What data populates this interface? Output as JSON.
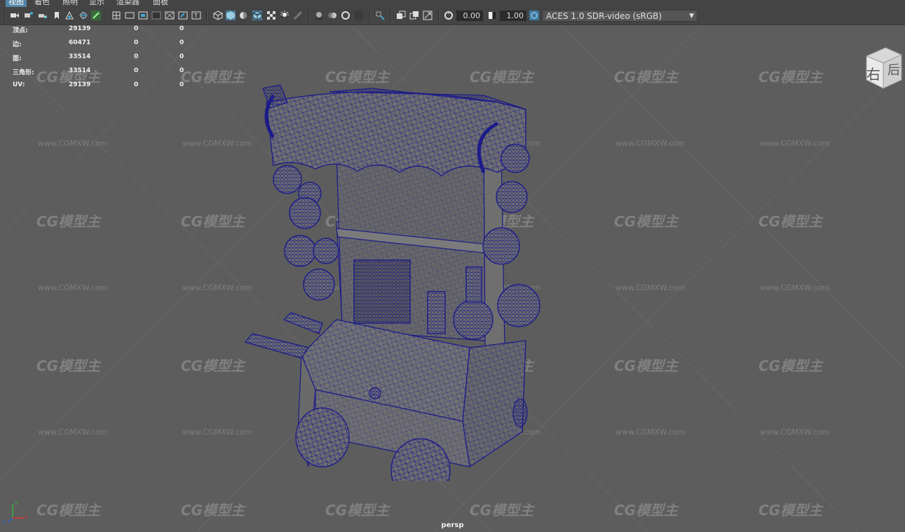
{
  "menu": {
    "items": [
      "视图",
      "着色",
      "照明",
      "显示",
      "渲染器",
      "面板"
    ]
  },
  "toolbar": {
    "exposure": "0.00",
    "gamma": "1.00",
    "color_space": "ACES 1.0 SDR-video (sRGB)",
    "icons": [
      "camera-icon",
      "camera-attributes-icon",
      "bookmark-icon",
      "image-plane-icon",
      "grid-icon",
      "film-gate-icon",
      "resolution-gate-icon",
      "gate-mask-icon",
      "field-chart-icon",
      "safe-action-icon",
      "wireframe-icon",
      "smooth-shade-icon",
      "shade-wireframe-icon",
      "textured-icon",
      "lights-icon",
      "shadows-icon",
      "ambient-occlusion-icon",
      "motion-blur-icon",
      "anti-alias-icon",
      "isolate-select-icon",
      "xray-icon",
      "xray-joints-icon",
      "backface-icon",
      "exposure-icon",
      "gamma-icon",
      "color-management-icon"
    ]
  },
  "hud": {
    "rows": [
      {
        "label": "顶点:",
        "v1": "29139",
        "v2": "0",
        "v3": "0"
      },
      {
        "label": "边:",
        "v1": "60471",
        "v2": "0",
        "v3": "0"
      },
      {
        "label": "面:",
        "v1": "33514",
        "v2": "0",
        "v3": "0"
      },
      {
        "label": "三角形:",
        "v1": "33514",
        "v2": "0",
        "v3": "0"
      },
      {
        "label": "UV:",
        "v1": "29139",
        "v2": "0",
        "v3": "0"
      }
    ]
  },
  "viewcube": {
    "right_label": "右",
    "back_label": "后"
  },
  "camera_label": "persp",
  "axis": {
    "x": "x",
    "y": "y",
    "z": "z"
  },
  "watermark": {
    "logo": "CG模型主",
    "url": "www.CGMXW.com"
  },
  "colors": {
    "viewport_bg": "#5d5d5d",
    "toolbar_bg": "#444444",
    "wire": "#1c1c8a",
    "model_fill": "#6f6f6f",
    "accent": "#5285a6"
  }
}
